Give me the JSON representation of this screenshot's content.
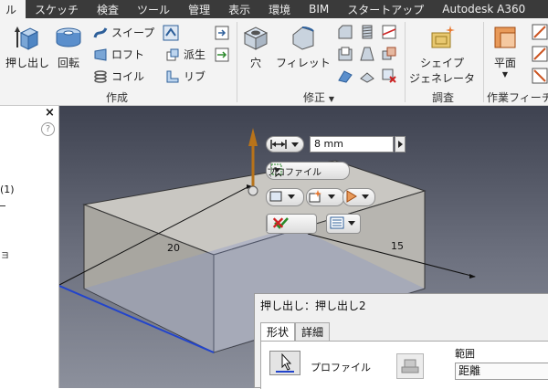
{
  "menubar": {
    "tabs": [
      "ル",
      "スケッチ",
      "検査",
      "ツール",
      "管理",
      "表示",
      "環境",
      "BIM",
      "スタートアップ",
      "Autodesk A360"
    ]
  },
  "ribbon": {
    "create": {
      "label": "作成",
      "extrude": "押し出し",
      "revolve": "回転",
      "sweep": "スイープ",
      "loft": "ロフト",
      "coil": "コイル",
      "derive": "派生",
      "rib": "リブ"
    },
    "modify": {
      "label": "修正",
      "label_arrow": "▼",
      "hole": "穴",
      "fillet": "フィレット"
    },
    "explore": {
      "label": "調査",
      "shape_generator_line1": "シェイプ",
      "shape_generator_line2": "ジェネレータ"
    },
    "work_features": {
      "label": "作業フィーチ",
      "plane": "平面",
      "plane_arrow": "▼"
    }
  },
  "panel": {
    "close": "×",
    "help": "?",
    "tree_item": "(1)",
    "mark": "ョ"
  },
  "viewport": {
    "dim_20": "20",
    "dim_15": "15"
  },
  "minitoolbar": {
    "distance_value": "8 mm",
    "profile_label": "プロファイル"
  },
  "dialog": {
    "title": "押し出し：押し出し2",
    "tab_shape": "形状",
    "tab_detail": "詳細",
    "profile_label": "プロファイル",
    "extents_label": "範囲",
    "extents_value": "距離"
  },
  "colors": {
    "menubar": "#3a3a3a",
    "ribbon": "#f3f3f3",
    "viewport_top": "#3e4250",
    "viewport_bottom": "#8c909c",
    "accept_green": "#2a8a2a",
    "cancel_red": "#cc2222",
    "edge_blue": "#2244cc"
  }
}
